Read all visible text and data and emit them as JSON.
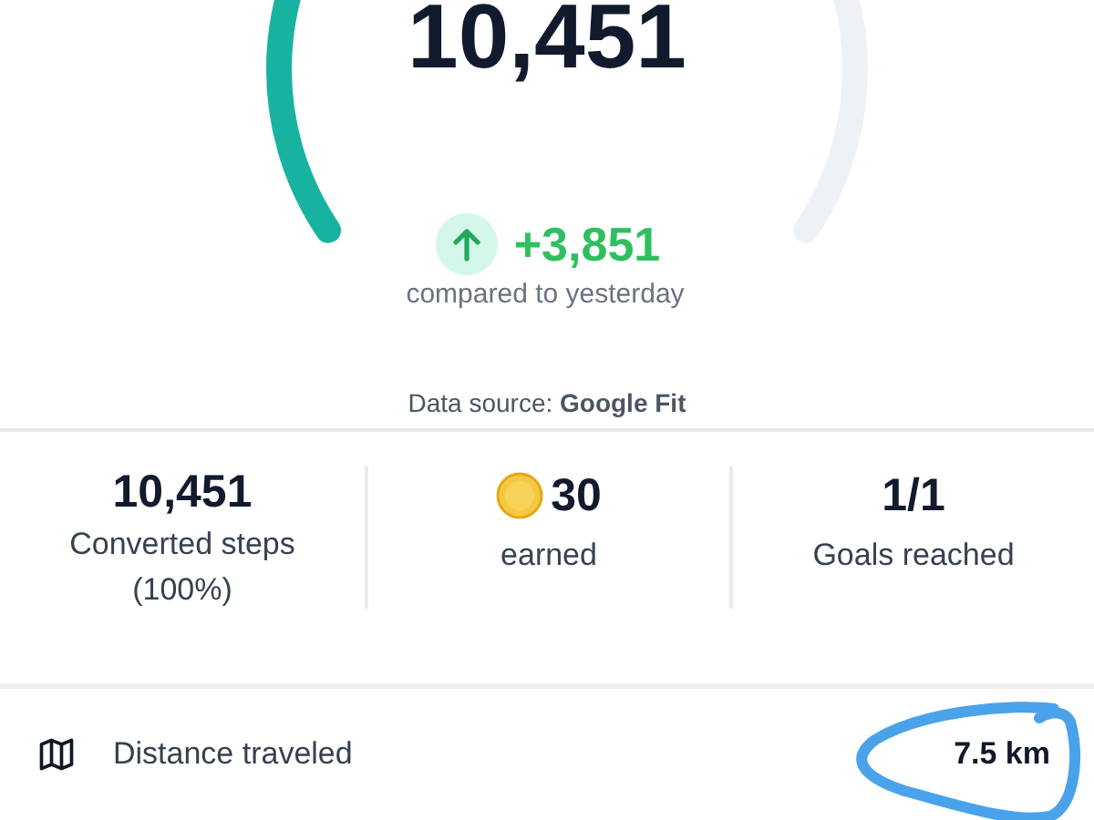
{
  "gauge": {
    "steps": "10,451"
  },
  "change": {
    "value": "+3,851",
    "caption": "compared to yesterday"
  },
  "data_source": "Data source: **Google Fit**",
  "stats": [
    {
      "kind": "plain",
      "value": "10,451",
      "label": "Converted steps (100%)"
    },
    {
      "kind": "coin",
      "value": "30",
      "label": "earned"
    },
    {
      "kind": "plain",
      "value": "1/1",
      "label": "Goals reached"
    }
  ],
  "distance": {
    "label": "Distance traveled",
    "value": "7.5 km"
  }
}
